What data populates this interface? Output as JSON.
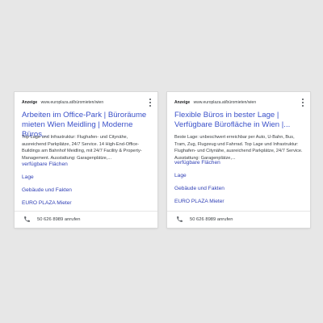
{
  "ads": [
    {
      "badge": "Anzeige",
      "url": "www.europlaza.at/büromieten/wien",
      "title": "Arbeiten im Office-Park | Büroräume mieten Wien Meidling | Moderne Büros...",
      "description": "Top Lage und Infrastruktur: Flughafen- und Citynähe, ausreichend Parkplätze, 24/7 Service. 14 High-End-Office-Buildings am Bahnhof Meidling, mit 24/7 Facility & Property-Management. Ausstattung: Garagenplätze,...",
      "sitelinks": [
        "verfügbare Flächen",
        "Lage",
        "Gebäude und Fakten",
        "EURO PLAZA Mieter"
      ],
      "phone": "50 626 8989 anrufen",
      "phone_icon": "phone-icon",
      "more_icon": "more-vert-icon"
    },
    {
      "badge": "Anzeige",
      "url": "www.europlaza.at/büromieten/wien",
      "title": "Flexible Büros in bester Lage | Verfügbare Bürofläche in Wien |...",
      "description": "Beste Lage: unbeschwert erreichbar per Auto, U-Bahn, Bus, Tram, Zug, Flugzeug und Fahrrad. Top Lage und Infrastruktur: Flughafen- und Citynähe, ausreichend Parkplätze, 24/7 Service. Ausstattung: Garagenplätze,...",
      "sitelinks": [
        "verfügbare Flächen",
        "Lage",
        "Gebäude und Fakten",
        "EURO PLAZA Mieter"
      ],
      "phone": "50 626 8989 anrufen",
      "phone_icon": "phone-icon",
      "more_icon": "more-vert-icon"
    }
  ],
  "colors": {
    "background": "#e7e7e7",
    "card": "#ffffff",
    "link": "#3b51c9",
    "text": "#3c4043"
  }
}
